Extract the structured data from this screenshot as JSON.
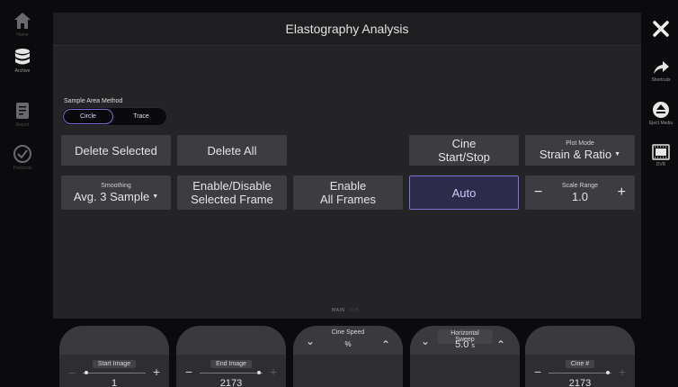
{
  "title": "Elastography Analysis",
  "left_nav": [
    {
      "label": "Home",
      "icon": "home-icon",
      "dim": true
    },
    {
      "label": "Archive",
      "icon": "database-icon",
      "dim": false
    },
    {
      "label": "Report",
      "icon": "report-icon",
      "dim": true
    },
    {
      "label": "Protocols",
      "icon": "check-circle-icon",
      "dim": true
    }
  ],
  "right_nav": [
    {
      "label": "",
      "icon": "close-icon"
    },
    {
      "label": "Shortcuts",
      "icon": "share-arrow-icon"
    },
    {
      "label": "Eject Media",
      "icon": "eject-icon"
    },
    {
      "label": "DVR",
      "icon": "dvr-icon"
    }
  ],
  "sample_area": {
    "label": "Sample Area Method",
    "options": [
      "Circle",
      "Trace"
    ],
    "selected": "Circle"
  },
  "buttons": {
    "delete_selected": "Delete Selected",
    "delete_all": "Delete All",
    "cine_line1": "Cine",
    "cine_line2": "Start/Stop",
    "plot_mode_label": "Plot Mode",
    "plot_mode_value": "Strain & Ratio",
    "smoothing_label": "Smoothing",
    "smoothing_value": "Avg. 3 Sample",
    "enable_disable_line1": "Enable/Disable",
    "enable_disable_line2": "Selected Frame",
    "enable_all_line1": "Enable",
    "enable_all_line2": "All Frames",
    "auto": "Auto",
    "scale_range_label": "Scale Range",
    "scale_range_value": "1.0",
    "minus": "−",
    "plus": "+"
  },
  "page_indicator": {
    "main": "MAIN",
    "sub": "SUB"
  },
  "knobs": {
    "start_image": {
      "label": "Start Image",
      "value": "1"
    },
    "end_image": {
      "label": "End Image",
      "value": "2173"
    },
    "cine_speed": {
      "label": "Cine Speed",
      "value": "%"
    },
    "horizontal_sweep": {
      "label": "Horizontal Sweep",
      "value": "5.0",
      "unit": "s"
    },
    "cine_number": {
      "label": "Cine #",
      "value": "2173"
    }
  },
  "colors": {
    "accent": "#7d73d8",
    "panel": "#242427",
    "button": "#3d3d41"
  }
}
